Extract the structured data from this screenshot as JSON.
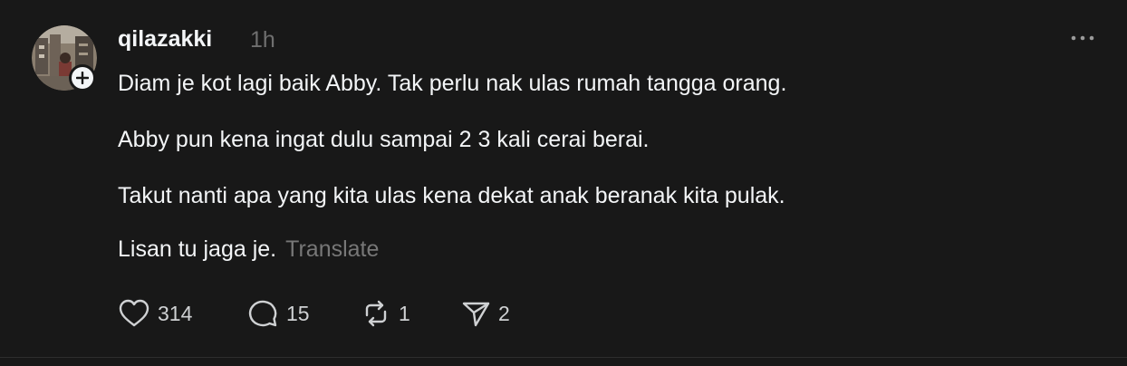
{
  "post": {
    "username": "qilazakki",
    "timestamp": "1h",
    "paragraphs": [
      "Diam je kot lagi baik Abby. Tak perlu nak ulas rumah tangga orang.",
      "Abby pun kena ingat dulu sampai 2 3 kali cerai berai.",
      "Takut nanti apa yang kita ulas kena dekat anak beranak kita pulak.",
      "Lisan tu jaga je."
    ],
    "translate_label": "Translate",
    "actions": {
      "likes": "314",
      "replies": "15",
      "reposts": "1",
      "shares": "2"
    }
  },
  "icons": {
    "like": "heart-icon",
    "reply": "speech-bubble-icon",
    "repost": "repost-icon",
    "share": "send-icon",
    "more": "more-horizontal-icon",
    "follow": "plus-icon"
  },
  "colors": {
    "background": "#181818",
    "text": "#f3f5f7",
    "muted": "#777777"
  }
}
